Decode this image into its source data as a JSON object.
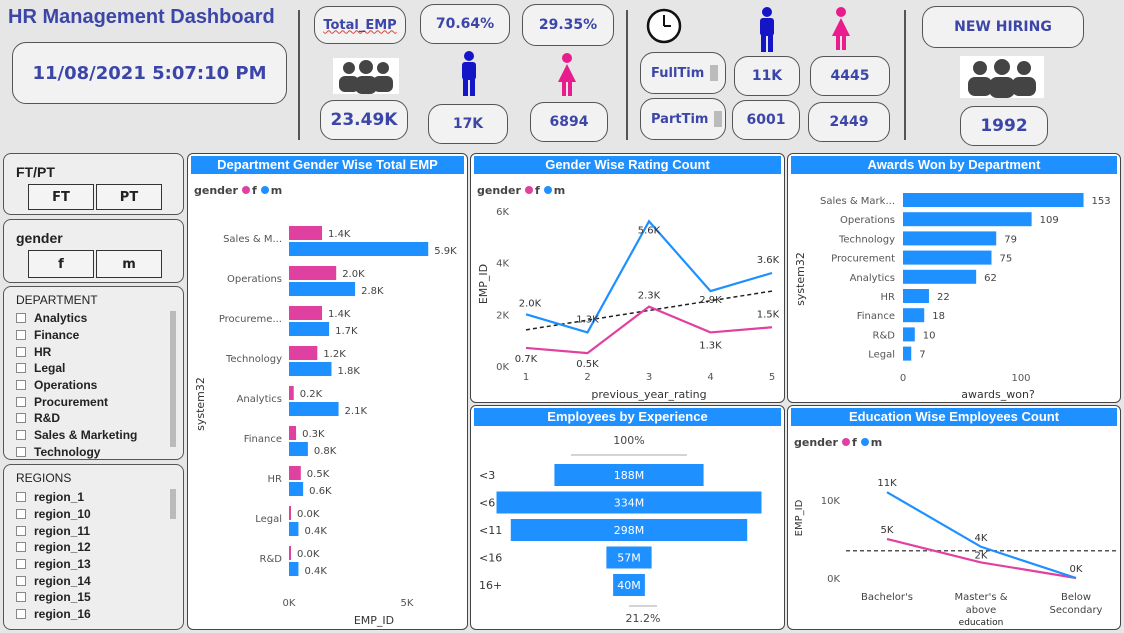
{
  "header": {
    "title": "HR Management Dashboard",
    "datetime": "11/08/2021 5:07:10 PM",
    "total_emp_label": "Total_EMP",
    "male_pct": "70.64%",
    "female_pct": "29.35%",
    "total_emp_value": "23.49K",
    "male_count": "17K",
    "female_count": "6894",
    "fulltime_label": "FullTim",
    "parttime_label": "PartTim",
    "ft_male": "11K",
    "ft_female": "4445",
    "pt_male": "6001",
    "pt_female": "2449",
    "new_hiring_label": "NEW HIRING",
    "new_hiring_value": "1992"
  },
  "colors": {
    "female": "#e040a0",
    "male": "#1e90ff",
    "header_blue": "#1e90ff",
    "text_blue": "#3b46a8"
  },
  "icons": [
    "people-group-icon",
    "male-icon",
    "female-icon",
    "clock-icon"
  ],
  "slicers": {
    "ftpt": {
      "title": "FT/PT",
      "options": [
        "FT",
        "PT"
      ]
    },
    "gender": {
      "title": "gender",
      "options": [
        "f",
        "m"
      ]
    },
    "department": {
      "title": "DEPARTMENT",
      "items": [
        "Analytics",
        "Finance",
        "HR",
        "Legal",
        "Operations",
        "Procurement",
        "R&D",
        "Sales & Marketing",
        "Technology"
      ]
    },
    "regions": {
      "title": "REGIONS",
      "items": [
        "region_1",
        "region_10",
        "region_11",
        "region_12",
        "region_13",
        "region_14",
        "region_15",
        "region_16"
      ]
    }
  },
  "legend": {
    "title": "gender",
    "f": "f",
    "m": "m"
  },
  "chart_data": [
    {
      "type": "bar",
      "orientation": "horizontal",
      "title": "Department Gender Wise Total EMP",
      "xlabel": "EMP_ID",
      "ylabel": "system32",
      "categories": [
        "Sales & M...",
        "Operations",
        "Procureme...",
        "Technology",
        "Analytics",
        "Finance",
        "HR",
        "Legal",
        "R&D"
      ],
      "series": [
        {
          "name": "f",
          "values": [
            1400,
            2000,
            1400,
            1200,
            200,
            300,
            500,
            0,
            0
          ],
          "labels": [
            "1.4K",
            "2.0K",
            "1.4K",
            "1.2K",
            "0.2K",
            "0.3K",
            "0.5K",
            "0.0K",
            "0.0K"
          ]
        },
        {
          "name": "m",
          "values": [
            5900,
            2800,
            1700,
            1800,
            2100,
            800,
            600,
            400,
            400
          ],
          "labels": [
            "5.9K",
            "2.8K",
            "1.7K",
            "1.8K",
            "2.1K",
            "0.8K",
            "0.6K",
            "0.4K",
            "0.4K"
          ]
        }
      ],
      "xticks": [
        "0K",
        "5K"
      ],
      "xlim": [
        0,
        7000
      ]
    },
    {
      "type": "line",
      "title": "Gender Wise Rating Count",
      "xlabel": "previous_year_rating",
      "ylabel": "EMP_ID",
      "x": [
        1,
        2,
        3,
        4,
        5
      ],
      "series": [
        {
          "name": "f",
          "values": [
            700,
            500,
            2300,
            1300,
            1500
          ],
          "labels": [
            "0.7K",
            "0.5K",
            "2.3K",
            "1.3K",
            "1.5K"
          ]
        },
        {
          "name": "m",
          "values": [
            2000,
            1300,
            5600,
            2900,
            3600
          ],
          "labels": [
            "2.0K",
            "1.3K",
            "5.6K",
            "2.9K",
            "3.6K"
          ]
        }
      ],
      "trend": [
        1400,
        2900
      ],
      "yticks": [
        "0K",
        "2K",
        "4K",
        "6K"
      ],
      "ylim": [
        0,
        6000
      ]
    },
    {
      "type": "bar",
      "orientation": "horizontal",
      "title": "Awards Won by Department",
      "xlabel": "awards_won?",
      "ylabel": "system32",
      "categories": [
        "Sales & Mark...",
        "Operations",
        "Technology",
        "Procurement",
        "Analytics",
        "HR",
        "Finance",
        "R&D",
        "Legal"
      ],
      "values": [
        153,
        109,
        79,
        75,
        62,
        22,
        18,
        10,
        7
      ],
      "xticks": [
        "0",
        "100"
      ],
      "xlim": [
        0,
        160
      ]
    },
    {
      "type": "funnel",
      "title": "Employees by Experience",
      "categories": [
        "<3",
        "<6",
        "<11",
        "<16",
        "16+"
      ],
      "values": [
        188,
        334,
        298,
        57,
        40
      ],
      "labels": [
        "188M",
        "334M",
        "298M",
        "57M",
        "40M"
      ],
      "top_pct": "100%",
      "bottom_pct": "21.2%"
    },
    {
      "type": "line",
      "title": "Education Wise Employees Count",
      "xlabel": "education",
      "ylabel": "EMP_ID",
      "categories": [
        "Bachelor's",
        "Master's & above",
        "Below Secondary"
      ],
      "series": [
        {
          "name": "f",
          "values": [
            5000,
            2000,
            0
          ],
          "labels": [
            "5K",
            "2K",
            ""
          ]
        },
        {
          "name": "m",
          "values": [
            11000,
            4000,
            0
          ],
          "labels": [
            "11K",
            "4K",
            "0K"
          ]
        }
      ],
      "avg_line": 3500,
      "yticks": [
        "0K",
        "10K"
      ],
      "ylim": [
        0,
        14000
      ]
    }
  ]
}
